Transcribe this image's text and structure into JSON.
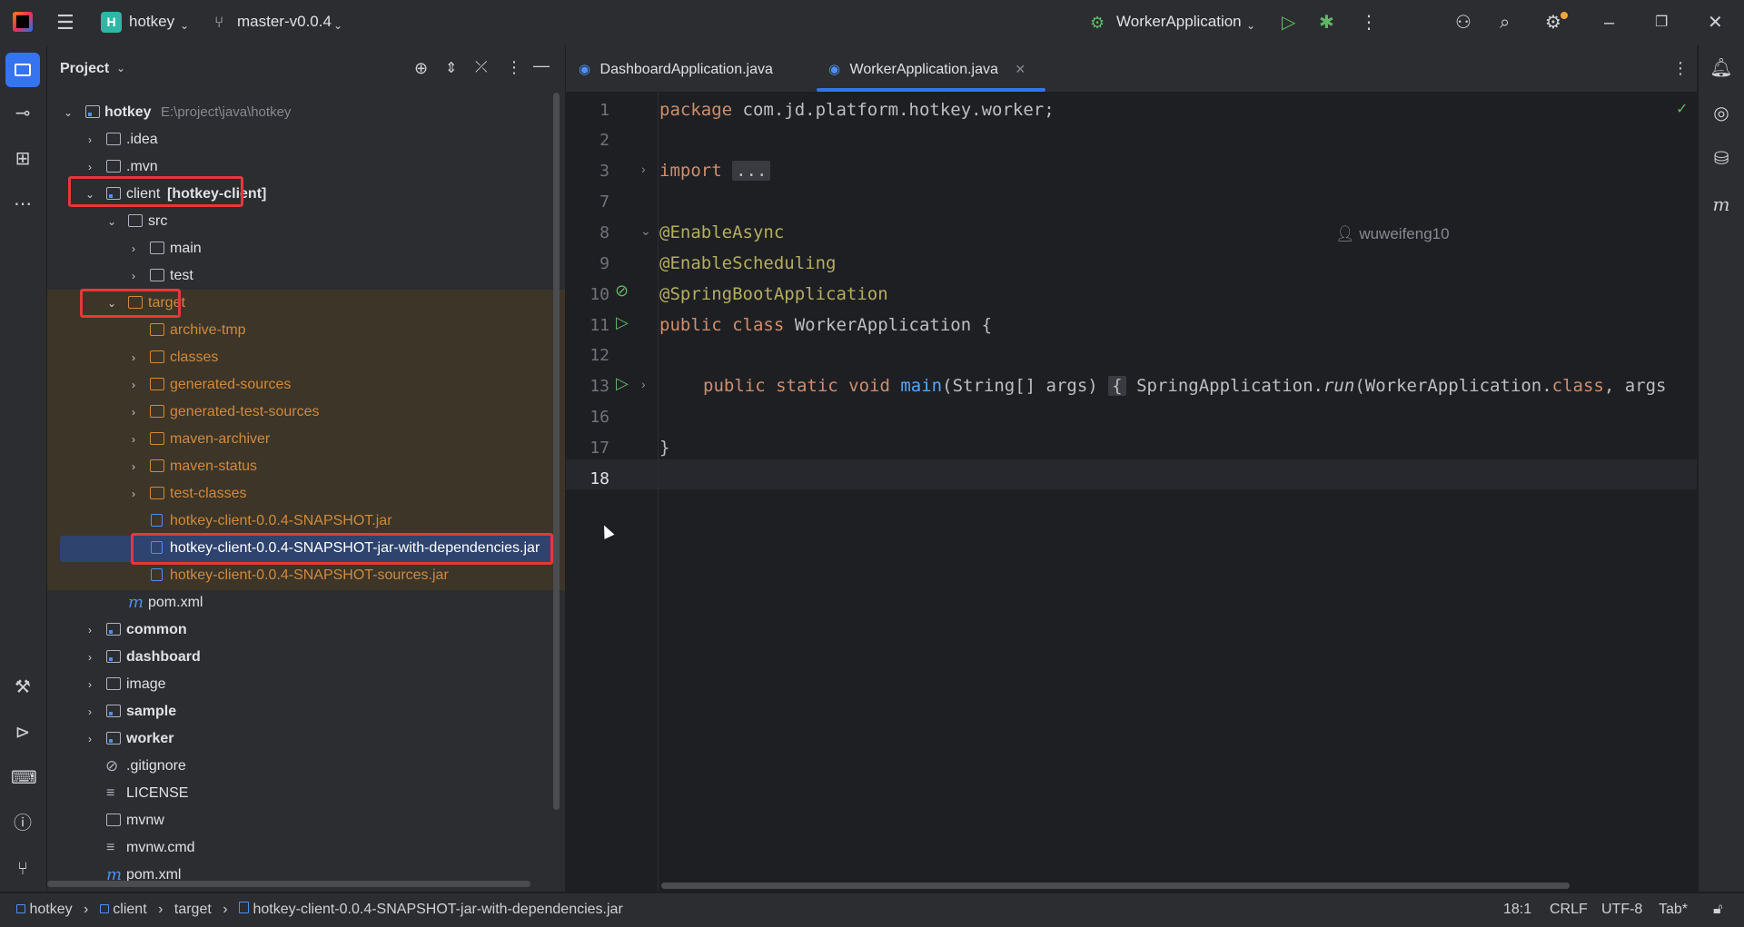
{
  "titlebar": {
    "project_badge": "H",
    "project_name": "hotkey",
    "branch": "master-v0.0.4",
    "run_config": "WorkerApplication"
  },
  "project_panel": {
    "title": "Project",
    "tree": [
      {
        "label": "hotkey",
        "path": "E:\\project\\java\\hotkey"
      },
      {
        "label": ".idea"
      },
      {
        "label": ".mvn"
      },
      {
        "label": "client",
        "module": "[hotkey-client]"
      },
      {
        "label": "src"
      },
      {
        "label": "main"
      },
      {
        "label": "test"
      },
      {
        "label": "target"
      },
      {
        "label": "archive-tmp"
      },
      {
        "label": "classes"
      },
      {
        "label": "generated-sources"
      },
      {
        "label": "generated-test-sources"
      },
      {
        "label": "maven-archiver"
      },
      {
        "label": "maven-status"
      },
      {
        "label": "test-classes"
      },
      {
        "label": "hotkey-client-0.0.4-SNAPSHOT.jar"
      },
      {
        "label": "hotkey-client-0.0.4-SNAPSHOT-jar-with-dependencies.jar"
      },
      {
        "label": "hotkey-client-0.0.4-SNAPSHOT-sources.jar"
      },
      {
        "label": "pom.xml"
      },
      {
        "label": "common"
      },
      {
        "label": "dashboard"
      },
      {
        "label": "image"
      },
      {
        "label": "sample"
      },
      {
        "label": "worker"
      },
      {
        "label": ".gitignore"
      },
      {
        "label": "LICENSE"
      },
      {
        "label": "mvnw"
      },
      {
        "label": "mvnw.cmd"
      },
      {
        "label": "pom.xml"
      }
    ]
  },
  "tabs": [
    {
      "label": "DashboardApplication.java"
    },
    {
      "label": "WorkerApplication.java"
    }
  ],
  "editor": {
    "line_numbers": [
      "1",
      "2",
      "3",
      "7",
      "8",
      "9",
      "10",
      "11",
      "12",
      "13",
      "16",
      "17",
      "18"
    ],
    "fold_placeholder": "...",
    "author_hint": "wuweifeng10",
    "code": {
      "l1_kw": "package",
      "l1_rest": " com.jd.platform.hotkey.worker;",
      "l3_kw": "import",
      "l8": "@EnableAsync",
      "l9": "@EnableScheduling",
      "l10": "@SpringBootApplication",
      "l11_kw": "public class",
      "l11_rest": " WorkerApplication {",
      "l13_kw": "public static void",
      "l13_fn": "main",
      "l13_args": "(String[] args)",
      "l13_brace": "{",
      "l13_call": "SpringApplication.",
      "l13_run": "run",
      "l13_tail1": "(WorkerApplication.",
      "l13_class": "class",
      "l13_tail2": ", args",
      "l17": "}"
    }
  },
  "statusbar": {
    "crumbs": [
      "hotkey",
      "client",
      "target",
      "hotkey-client-0.0.4-SNAPSHOT-jar-with-dependencies.jar"
    ],
    "position": "18:1",
    "line_sep": "CRLF",
    "encoding": "UTF-8",
    "indent": "Tab*"
  }
}
